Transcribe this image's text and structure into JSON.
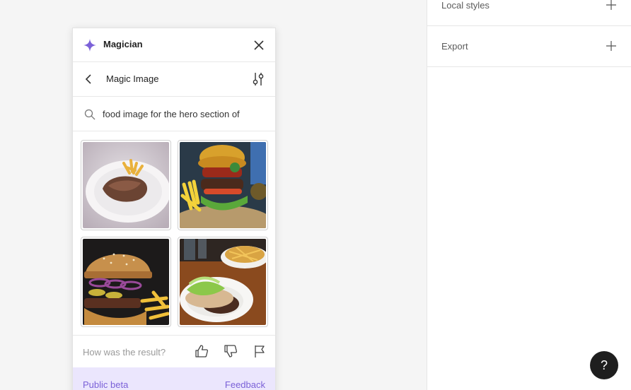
{
  "properties_panel": {
    "rows": [
      {
        "label": "Local styles"
      },
      {
        "label": "Export"
      }
    ]
  },
  "plugin": {
    "title": "Magician",
    "sub_title": "Magic Image",
    "search": {
      "value": "food image for the hero section of"
    },
    "results": [
      {
        "icon": "steak-fries-image"
      },
      {
        "icon": "burger-fries-image"
      },
      {
        "icon": "burger-onion-image"
      },
      {
        "icon": "burger-fries-table-image"
      }
    ],
    "feedback_question": "How was the result?",
    "beta_label": "Public beta",
    "feedback_link": "Feedback"
  },
  "help": {
    "label": "?"
  },
  "colors": {
    "accent": "#7b61d8",
    "beta_background": "#ebe6fd"
  }
}
